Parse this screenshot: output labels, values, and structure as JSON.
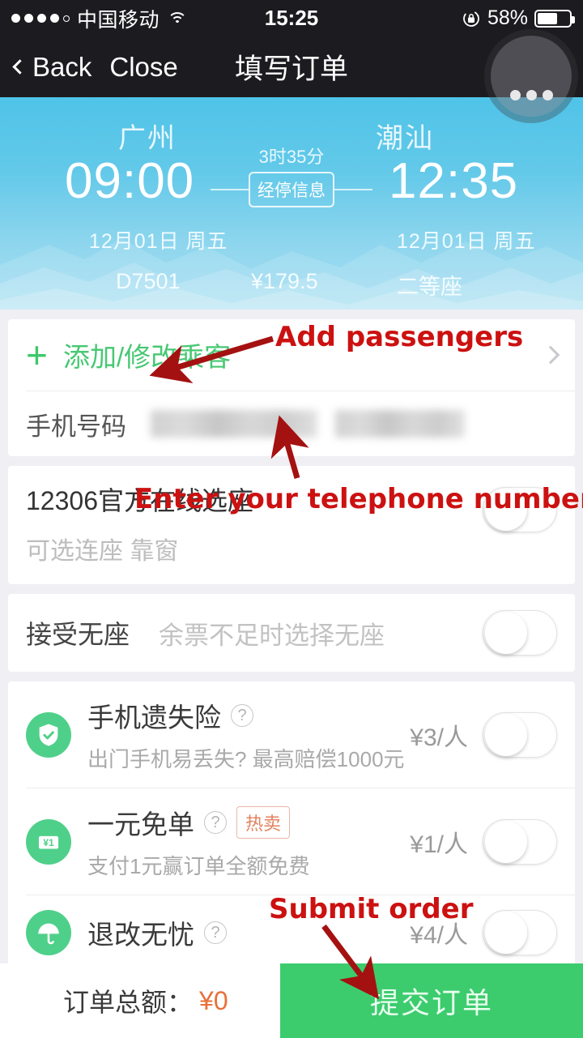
{
  "statusbar": {
    "carrier": "中国移动",
    "time": "15:25",
    "battery_percent": "58%",
    "signal_filled": 4,
    "signal_total": 5,
    "wifi_icon": "wifi-icon",
    "lock_icon": "rotation-lock-icon",
    "battery_icon": "battery-icon"
  },
  "navbar": {
    "back_label": "Back",
    "close_label": "Close",
    "title": "填写订单",
    "back_icon": "chevron-left-icon",
    "assistive_icon": "assistive-touch-icon"
  },
  "train": {
    "from_city": "广州",
    "to_city": "潮汕",
    "depart_time": "09:00",
    "arrive_time": "12:35",
    "duration": "3时35分",
    "stop_info_label": "经停信息",
    "depart_date": "12月01日  周五",
    "arrive_date": "12月01日  周五",
    "train_no": "D7501",
    "price": "¥179.5",
    "seat_type": "二等座"
  },
  "passenger": {
    "add_label": "添加/修改乘客",
    "plus_icon": "plus-icon",
    "chevron_icon": "chevron-right-icon",
    "phone_label": "手机号码",
    "phone_value": "",
    "phone_placeholder": ""
  },
  "seat_selection": {
    "title": "12306官方在线选座",
    "subtitle": "可选连座 靠窗",
    "toggle_state": "off"
  },
  "no_seat": {
    "title": "接受无座",
    "subtitle": "余票不足时选择无座",
    "toggle_state": "off"
  },
  "insurance": [
    {
      "icon": "shield-check-icon",
      "title": "手机遗失险",
      "help_icon": "question-mark-icon",
      "badge": "",
      "subtitle": "出门手机易丢失? 最高赔偿1000元",
      "price": "¥3/人",
      "toggle_state": "off"
    },
    {
      "icon": "yen-one-icon",
      "title": "一元免单",
      "help_icon": "question-mark-icon",
      "badge": "热卖",
      "subtitle": "支付1元赢订单全额免费",
      "price": "¥1/人",
      "toggle_state": "off"
    },
    {
      "icon": "umbrella-icon",
      "title": "退改无忧",
      "help_icon": "question-mark-icon",
      "badge": "",
      "subtitle": "",
      "price": "¥4/人",
      "toggle_state": "off"
    }
  ],
  "bottom": {
    "total_label": "订单总额：",
    "total_value": "¥0",
    "submit_label": "提交订单"
  },
  "annotations": [
    {
      "text": "Add passengers"
    },
    {
      "text": "Enter your telephone number"
    },
    {
      "text": "Submit order"
    }
  ],
  "colors": {
    "accent_green": "#3ccc6e",
    "header_blue": "#63c9e9",
    "annotation_red": "#cc1111",
    "price_orange": "#e8703a"
  }
}
